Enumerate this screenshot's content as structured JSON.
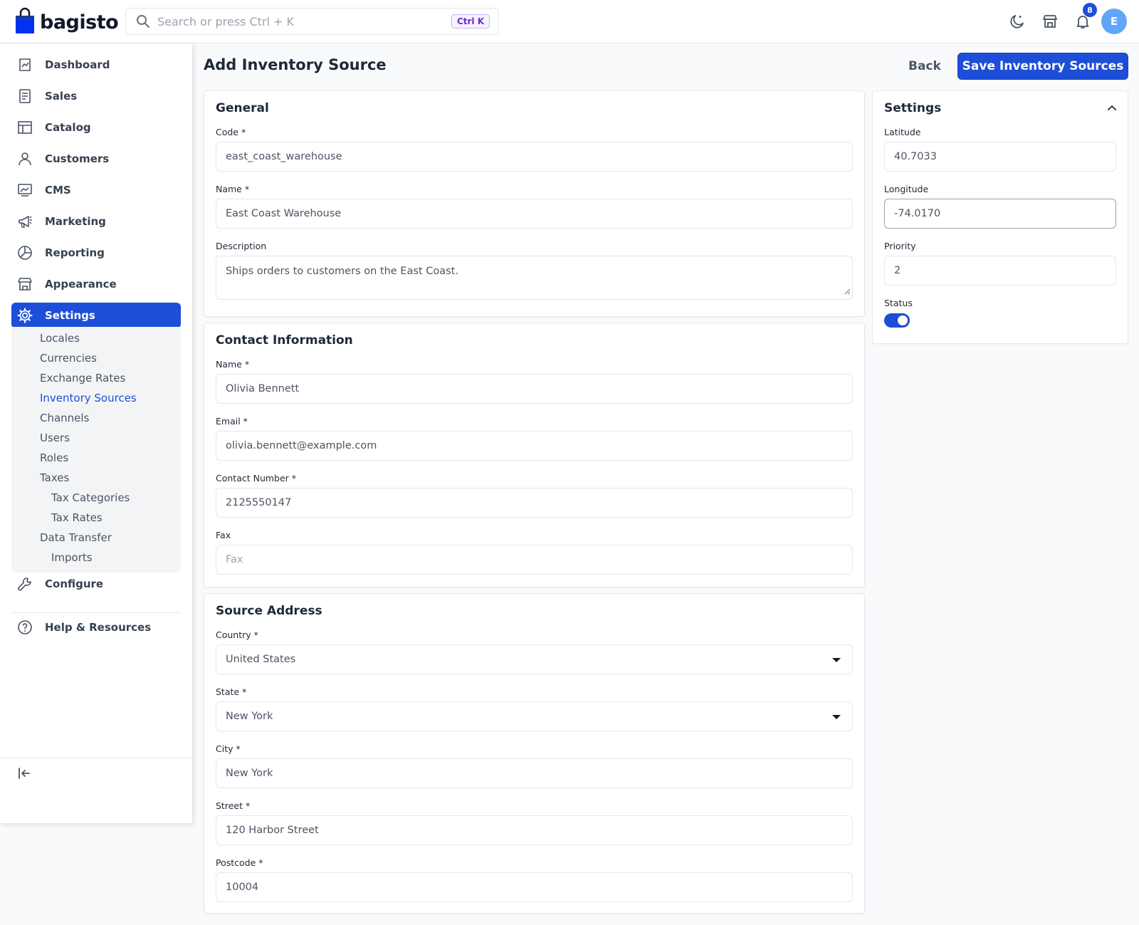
{
  "header": {
    "brand": "bagisto",
    "search_placeholder": "Search or press Ctrl + K",
    "search_shortcut": "Ctrl K",
    "notification_count": "8",
    "avatar_initial": "E",
    "icons": [
      "moon-sparkle-icon",
      "store-icon",
      "bell-icon"
    ]
  },
  "sidebar": {
    "items": [
      {
        "label": "Dashboard",
        "icon": "dashboard-icon"
      },
      {
        "label": "Sales",
        "icon": "receipt-icon"
      },
      {
        "label": "Catalog",
        "icon": "catalog-icon"
      },
      {
        "label": "Customers",
        "icon": "user-icon"
      },
      {
        "label": "CMS",
        "icon": "monitor-icon"
      },
      {
        "label": "Marketing",
        "icon": "megaphone-icon"
      },
      {
        "label": "Reporting",
        "icon": "pie-chart-icon"
      },
      {
        "label": "Appearance",
        "icon": "storefront-icon"
      },
      {
        "label": "Settings",
        "icon": "gear-icon"
      },
      {
        "label": "Configure",
        "icon": "wrench-icon"
      },
      {
        "label": "Help & Resources",
        "icon": "help-icon"
      }
    ],
    "settings_sub": [
      "Locales",
      "Currencies",
      "Exchange Rates",
      "Inventory Sources",
      "Channels",
      "Users",
      "Roles",
      "Taxes",
      "Tax Categories",
      "Tax Rates",
      "Data Transfer",
      "Imports"
    ],
    "active_sub": "Inventory Sources"
  },
  "page": {
    "title": "Add Inventory Source",
    "back_label": "Back",
    "save_label": "Save Inventory Sources"
  },
  "general": {
    "title": "General",
    "code_label": "Code *",
    "code_value": "east_coast_warehouse",
    "name_label": "Name *",
    "name_value": "East Coast Warehouse",
    "description_label": "Description",
    "description_value": "Ships orders to customers on the East Coast."
  },
  "contact": {
    "title": "Contact Information",
    "name_label": "Name *",
    "name_value": "Olivia Bennett",
    "email_label": "Email *",
    "email_value": "olivia.bennett@example.com",
    "number_label": "Contact Number *",
    "number_value": "2125550147",
    "fax_label": "Fax",
    "fax_placeholder": "Fax"
  },
  "address": {
    "title": "Source Address",
    "country_label": "Country *",
    "country_value": "United States",
    "state_label": "State *",
    "state_value": "New York",
    "city_label": "City *",
    "city_value": "New York",
    "street_label": "Street *",
    "street_value": "120 Harbor Street",
    "postcode_label": "Postcode *",
    "postcode_value": "10004"
  },
  "settings_panel": {
    "title": "Settings",
    "latitude_label": "Latitude",
    "latitude_value": "40.7033",
    "longitude_label": "Longitude",
    "longitude_value": "-74.0170",
    "priority_label": "Priority",
    "priority_value": "2",
    "status_label": "Status",
    "status_on": true
  },
  "colors": {
    "accent": "#1d4ed8",
    "text": "#1f2937",
    "muted": "#4b5563",
    "border": "#e5e7eb"
  }
}
